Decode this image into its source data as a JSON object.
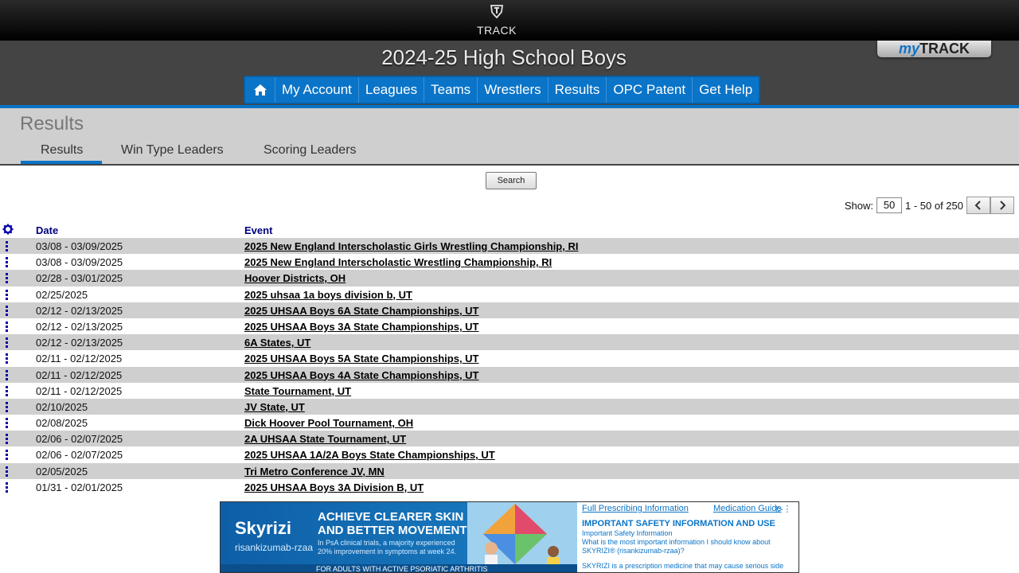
{
  "app": {
    "logo_text": "TRACK",
    "season_title": "2024-25 High School Boys",
    "mytrack_my": "my",
    "mytrack_track": "TRACK",
    "accent_color": "#0a74c8"
  },
  "nav": {
    "home_icon": "home-icon",
    "items": [
      "My Account",
      "Leagues",
      "Teams",
      "Wrestlers",
      "Results",
      "OPC Patent",
      "Get Help"
    ]
  },
  "page": {
    "title": "Results",
    "tabs": [
      "Results",
      "Win Type Leaders",
      "Scoring Leaders"
    ],
    "active_tab": "Results"
  },
  "search": {
    "button_label": "Search"
  },
  "pager": {
    "show_label": "Show:",
    "show_value": "50",
    "range_text": "1 - 50 of 250",
    "prev_icon": "chevron-left-icon",
    "next_icon": "chevron-right-icon"
  },
  "table": {
    "settings_icon": "gear-icon",
    "columns": {
      "date": "Date",
      "event": "Event"
    },
    "rows": [
      {
        "date": "03/08 - 03/09/2025",
        "event": "2025 New England Interscholastic Girls Wrestling Championship, RI"
      },
      {
        "date": "03/08 - 03/09/2025",
        "event": "2025 New England Interscholastic Wrestling Championship, RI"
      },
      {
        "date": "02/28 - 03/01/2025",
        "event": "Hoover Districts, OH"
      },
      {
        "date": "02/25/2025",
        "event": "2025 uhsaa 1a boys division b, UT"
      },
      {
        "date": "02/12 - 02/13/2025",
        "event": "2025 UHSAA Boys 6A State Championships, UT"
      },
      {
        "date": "02/12 - 02/13/2025",
        "event": "2025 UHSAA Boys 3A State Championships, UT"
      },
      {
        "date": "02/12 - 02/13/2025",
        "event": "6A States, UT"
      },
      {
        "date": "02/11 - 02/12/2025",
        "event": "2025 UHSAA Boys 5A State Championships, UT"
      },
      {
        "date": "02/11 - 02/12/2025",
        "event": "2025 UHSAA Boys 4A State Championships, UT"
      },
      {
        "date": "02/11 - 02/12/2025",
        "event": "State Tournament, UT"
      },
      {
        "date": "02/10/2025",
        "event": "JV State, UT"
      },
      {
        "date": "02/08/2025",
        "event": "Dick Hoover Pool Tournament, OH"
      },
      {
        "date": "02/06 - 02/07/2025",
        "event": "2A UHSAA State Tournament, UT"
      },
      {
        "date": "02/06 - 02/07/2025",
        "event": "2025 UHSAA 1A/2A Boys State Championships, UT"
      },
      {
        "date": "02/05/2025",
        "event": "Tri Metro Conference JV, MN"
      },
      {
        "date": "01/31 - 02/01/2025",
        "event": "2025 UHSAA Boys 3A Division B, UT"
      }
    ]
  },
  "ad": {
    "brand": "Skyrizi",
    "generic": "risankizumab-rzaa",
    "headline_1": "ACHIEVE CLEARER SKIN",
    "headline_2": "AND BETTER MOVEMENT",
    "body": "In PsA clinical trials, a majority experienced 20% improvement in symptoms at week 24.",
    "footer": "FOR ADULTS WITH ACTIVE PSORIATIC ARTHRITIS",
    "link_1": "Full Prescribing Information",
    "link_2": "Medication Guide",
    "isi_title": "IMPORTANT SAFETY INFORMATION AND USE",
    "isi_sub": "Important Safety Information",
    "isi_q": "What is the most important information I should know about SKYRIZI® (risankizumab-rzaa)?",
    "isi_foot": "SKYRIZI is a prescription medicine that may cause serious side"
  }
}
